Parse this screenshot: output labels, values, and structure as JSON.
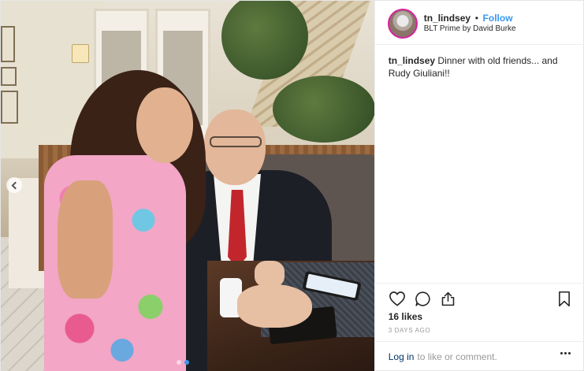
{
  "post": {
    "header": {
      "username": "tn_lindsey",
      "separator": "•",
      "follow_label": "Follow",
      "location": "BLT Prime by David Burke"
    },
    "caption": {
      "username": "tn_lindsey",
      "text": "Dinner with old friends... and Rudy Giuliani!!"
    },
    "likes": "16 likes",
    "timestamp": "3 DAYS AGO",
    "comment_bar": {
      "login_label": "Log in",
      "rest": "to like or comment."
    },
    "icons": [
      "heart-icon",
      "comment-icon",
      "share-icon",
      "bookmark-icon",
      "more-options-icon",
      "carousel-prev-icon"
    ],
    "carousel": {
      "slides": 2,
      "active": 1
    },
    "colors": {
      "follow": "#3897f0",
      "login": "#003569",
      "muted": "#999999",
      "text": "#262626"
    }
  }
}
